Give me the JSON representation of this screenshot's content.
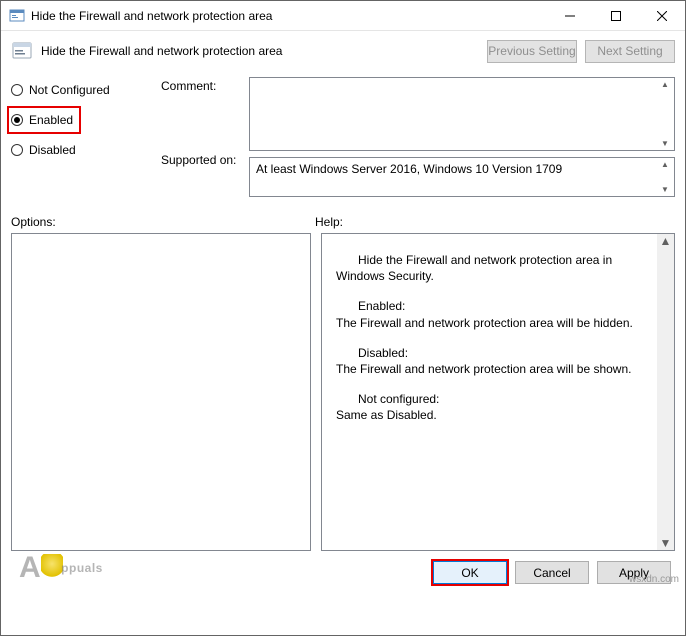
{
  "window": {
    "title": "Hide the Firewall and network protection area"
  },
  "header": {
    "policy_name": "Hide the Firewall and network protection area",
    "prev_btn": "Previous Setting",
    "next_btn": "Next Setting"
  },
  "state": {
    "not_configured": "Not Configured",
    "enabled": "Enabled",
    "disabled": "Disabled",
    "selected": "enabled"
  },
  "comment": {
    "label": "Comment:",
    "value": ""
  },
  "supported": {
    "label": "Supported on:",
    "value": "At least Windows Server 2016, Windows 10 Version 1709"
  },
  "labels": {
    "options": "Options:",
    "help": "Help:"
  },
  "help": {
    "p1": "Hide the Firewall and network protection area in Windows Security.",
    "p2a": "Enabled:",
    "p2b": "The Firewall and network protection area will be hidden.",
    "p3a": "Disabled:",
    "p3b": "The Firewall and network protection area will be shown.",
    "p4a": "Not configured:",
    "p4b": "Same as Disabled."
  },
  "buttons": {
    "ok": "OK",
    "cancel": "Cancel",
    "apply": "Apply"
  },
  "watermark": {
    "brand": "ppuals",
    "attrib": "wsxdn.com"
  }
}
